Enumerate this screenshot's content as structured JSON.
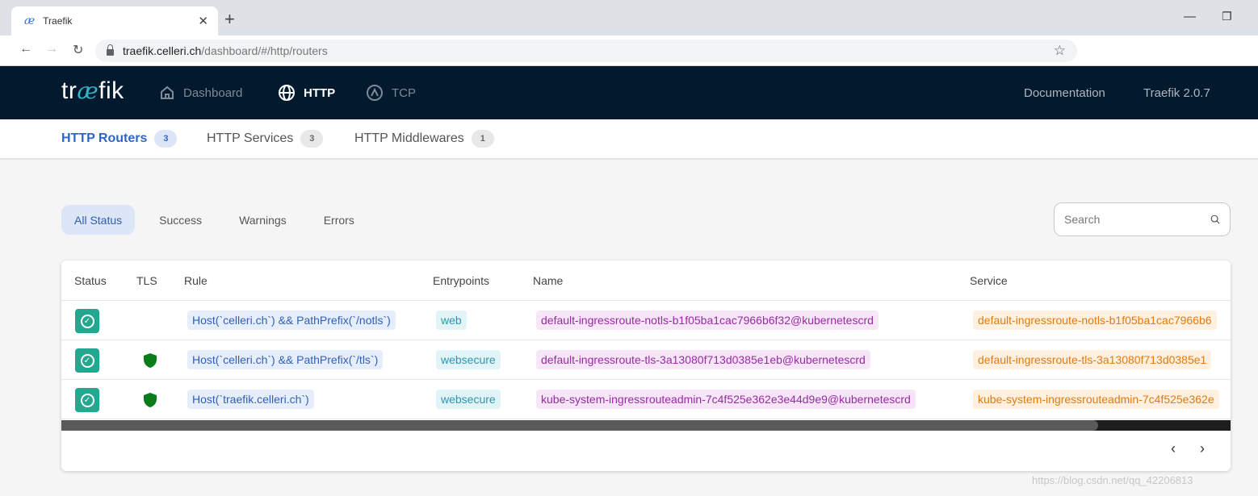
{
  "browser": {
    "tab_icon": "æ",
    "tab_title": "Traefik",
    "tab_close": "✕",
    "new_tab": "+",
    "url_host": "traefik.celleri.ch",
    "url_path": "/dashboard/#/http/routers"
  },
  "nav": {
    "logo_pre": "tr",
    "logo_ae": "æ",
    "logo_post": "fik",
    "items": [
      {
        "label": "Dashboard",
        "icon": "home-icon"
      },
      {
        "label": "HTTP",
        "icon": "globe-icon"
      },
      {
        "label": "TCP",
        "icon": "tcp-icon"
      }
    ],
    "documentation": "Documentation",
    "version": "Traefik 2.0.7"
  },
  "subtabs": [
    {
      "label": "HTTP Routers",
      "count": "3"
    },
    {
      "label": "HTTP Services",
      "count": "3"
    },
    {
      "label": "HTTP Middlewares",
      "count": "1"
    }
  ],
  "filters": [
    "All Status",
    "Success",
    "Warnings",
    "Errors"
  ],
  "search": {
    "placeholder": "Search"
  },
  "table": {
    "headers": [
      "Status",
      "TLS",
      "Rule",
      "Entrypoints",
      "Name",
      "Service"
    ],
    "rows": [
      {
        "status": "success",
        "tls": false,
        "rule": "Host(`celleri.ch`) && PathPrefix(`/notls`)",
        "entrypoint": "web",
        "name": "default-ingressroute-notls-b1f05ba1cac7966b6f32@kubernetescrd",
        "service": "default-ingressroute-notls-b1f05ba1cac7966b6"
      },
      {
        "status": "success",
        "tls": true,
        "rule": "Host(`celleri.ch`) && PathPrefix(`/tls`)",
        "entrypoint": "websecure",
        "name": "default-ingressroute-tls-3a13080f713d0385e1eb@kubernetescrd",
        "service": "default-ingressroute-tls-3a13080f713d0385e1"
      },
      {
        "status": "success",
        "tls": true,
        "rule": "Host(`traefik.celleri.ch`)",
        "entrypoint": "websecure",
        "name": "kube-system-ingressrouteadmin-7c4f525e362e3e44d9e9@kubernetescrd",
        "service": "kube-system-ingressrouteadmin-7c4f525e362e"
      }
    ]
  },
  "pager": {
    "prev": "‹",
    "next": "›"
  },
  "watermark": "https://blog.csdn.net/qq_42206813",
  "colors": {
    "nav_bg": "#03192d",
    "success": "#23a88f",
    "tls_shield": "#0a7d1a",
    "accent": "#2f66c6"
  }
}
